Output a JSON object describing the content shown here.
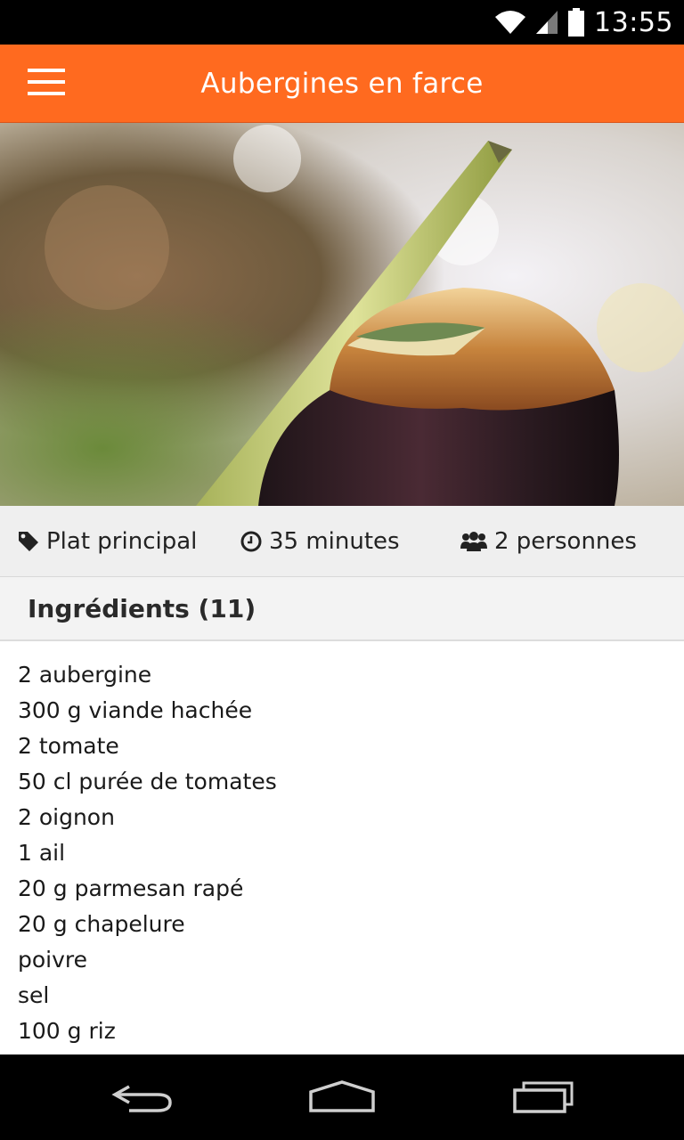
{
  "status_bar": {
    "time": "13:55",
    "icons": [
      "wifi-icon",
      "signal-icon",
      "battery-icon"
    ]
  },
  "action_bar": {
    "title": "Aubergines en farce",
    "menu_icon": "hamburger-menu-icon",
    "background": "#ff6a1f"
  },
  "hero": {
    "image": "stuffed-aubergine-photo"
  },
  "info": {
    "category": "Plat principal",
    "category_icon": "tag-icon",
    "duration": "35 minutes",
    "duration_icon": "clock-icon",
    "servings": "2 personnes",
    "servings_icon": "users-icon"
  },
  "ingredients": {
    "header": "Ingrédients (11)",
    "items": [
      "2 aubergine",
      "300 g viande hachée",
      "2 tomate",
      "50 cl purée de tomates",
      "2 oignon",
      "1 ail",
      "20 g parmesan rapé",
      "20 g chapelure",
      "poivre",
      "sel",
      "100 g riz"
    ]
  },
  "nav_bar": {
    "buttons": [
      "back-icon",
      "home-icon",
      "recent-apps-icon"
    ]
  }
}
